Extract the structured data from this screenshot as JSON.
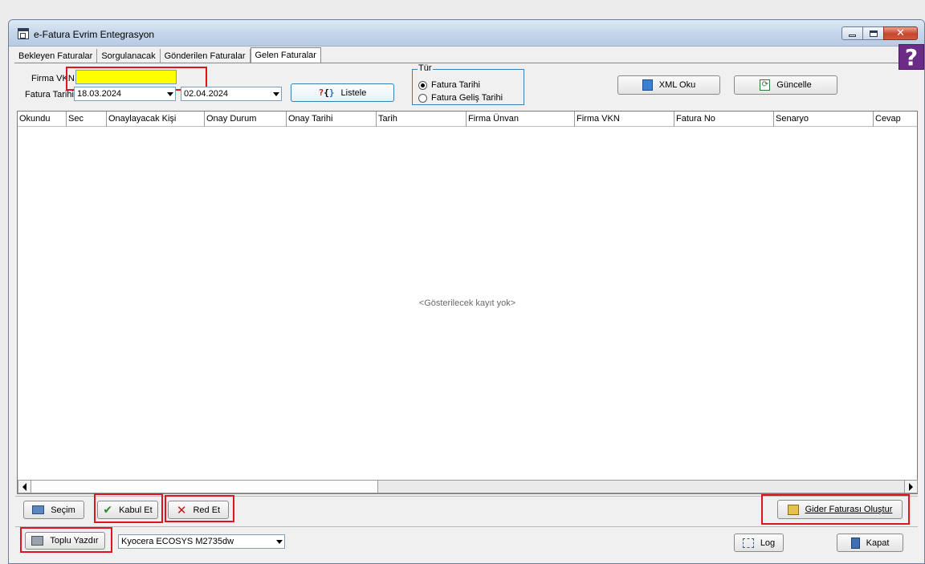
{
  "window": {
    "title": "e-Fatura Evrim Entegrasyon"
  },
  "tabs": [
    {
      "label": "Bekleyen Faturalar",
      "active": false
    },
    {
      "label": "Sorgulanacak",
      "active": false
    },
    {
      "label": "Gönderilen Faturalar",
      "active": false
    },
    {
      "label": "Gelen Faturalar",
      "active": true
    }
  ],
  "help": {
    "glyph": "?"
  },
  "filters": {
    "vkn_label": "Firma VKN",
    "vkn_value": "",
    "date_label": "Fatura Tarihi",
    "date_from": "18.03.2024",
    "date_to": "02.04.2024",
    "list_button": "Listele",
    "list_icon_glyph": "?{}"
  },
  "type_group": {
    "legend": "Tür",
    "options": [
      {
        "label": "Fatura Tarihi",
        "selected": true
      },
      {
        "label": "Fatura Geliş Tarihi",
        "selected": false
      }
    ]
  },
  "top_actions": {
    "xml_button": "XML Oku",
    "update_button": "Güncelle"
  },
  "grid": {
    "columns": [
      "Okundu",
      "Sec",
      "Onaylayacak Kişi",
      "Onay Durum",
      "Onay Tarihi",
      "Tarih",
      "Firma Ünvan",
      "Firma VKN",
      "Fatura No",
      "Senaryo",
      "Cevap"
    ],
    "empty_message": "<Gösterilecek kayıt yok>"
  },
  "bottom_actions": {
    "select_button": "Seçim",
    "accept_button": "Kabul Et",
    "reject_button": "Red Et",
    "expense_button": "Gider Faturası Oluştur",
    "print_button": "Toplu Yazdır",
    "printer_value": "Kyocera ECOSYS M2735dw",
    "log_button": "Log",
    "close_button": "Kapat"
  },
  "colors": {
    "highlight_box": "#e0141e",
    "vkn_input": "#ffff00",
    "help_bg": "#6b2b86"
  }
}
